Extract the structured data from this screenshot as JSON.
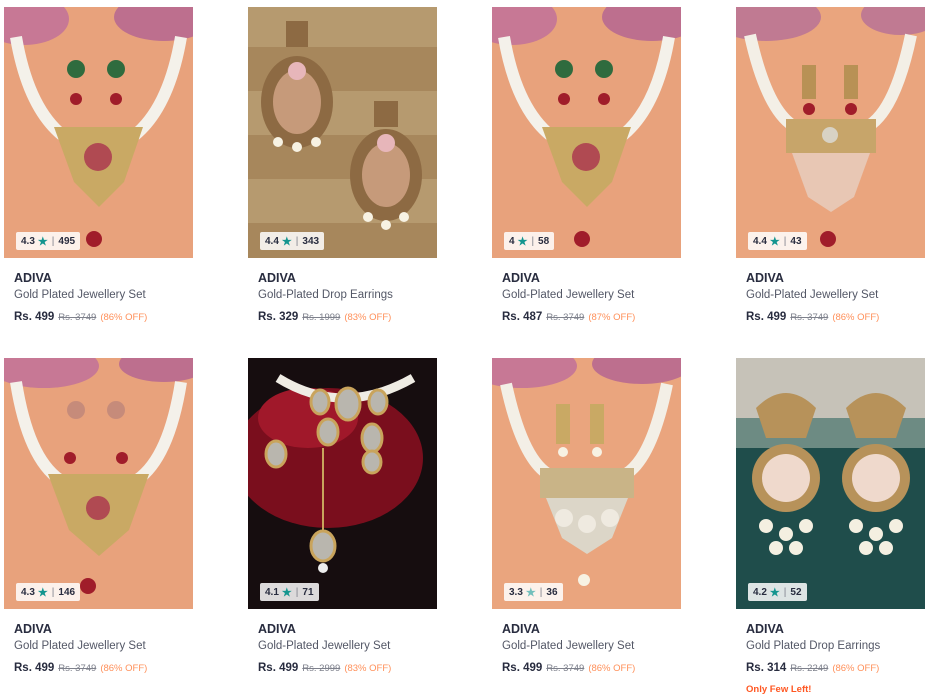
{
  "products": [
    {
      "brand": "ADIVA",
      "name": "Gold Plated Jewellery Set",
      "price": "Rs. 499",
      "mrp": "Rs. 3749",
      "discount": "(86% OFF)",
      "rating": "4.3",
      "count": "495",
      "image": "necklace-set-pink-green",
      "star_color": "#14958f"
    },
    {
      "brand": "ADIVA",
      "name": "Gold-Plated Drop Earrings",
      "price": "Rs. 329",
      "mrp": "Rs. 1999",
      "discount": "(83% OFF)",
      "rating": "4.4",
      "count": "343",
      "image": "drop-earrings-wood",
      "star_color": "#14958f"
    },
    {
      "brand": "ADIVA",
      "name": "Gold-Plated Jewellery Set",
      "price": "Rs. 487",
      "mrp": "Rs. 3749",
      "discount": "(87% OFF)",
      "rating": "4",
      "count": "58",
      "image": "necklace-set-pink-green",
      "star_color": "#14958f"
    },
    {
      "brand": "ADIVA",
      "name": "Gold-Plated Jewellery Set",
      "price": "Rs. 499",
      "mrp": "Rs. 3749",
      "discount": "(86% OFF)",
      "rating": "4.4",
      "count": "43",
      "image": "choker-set-peach",
      "star_color": "#14958f"
    },
    {
      "brand": "ADIVA",
      "name": "Gold Plated Jewellery Set",
      "price": "Rs. 499",
      "mrp": "Rs. 3749",
      "discount": "(86% OFF)",
      "rating": "4.3",
      "count": "146",
      "image": "necklace-set-pink",
      "star_color": "#14958f"
    },
    {
      "brand": "ADIVA",
      "name": "Gold-Plated Jewellery Set",
      "price": "Rs. 499",
      "mrp": "Rs. 2999",
      "discount": "(83% OFF)",
      "rating": "4.1",
      "count": "71",
      "image": "kundan-choker-red",
      "star_color": "#14958f"
    },
    {
      "brand": "ADIVA",
      "name": "Gold-Plated Jewellery Set",
      "price": "Rs. 499",
      "mrp": "Rs. 3749",
      "discount": "(86% OFF)",
      "rating": "3.3",
      "count": "36",
      "image": "necklace-set-white",
      "star_color": "#72bfbc"
    },
    {
      "brand": "ADIVA",
      "name": "Gold Plated Drop Earrings",
      "price": "Rs. 314",
      "mrp": "Rs. 2249",
      "discount": "(86% OFF)",
      "rating": "4.2",
      "count": "52",
      "image": "pearl-earrings-teal",
      "star_color": "#14958f",
      "urgency": "Only Few Left!"
    }
  ],
  "rating_star_icon": "star-icon",
  "rating_separator": "|",
  "colors": {
    "accent_teal": "#14958f",
    "discount_orange": "#ff905a",
    "urgency_red": "#ff5722",
    "text_dark": "#282c3f"
  }
}
